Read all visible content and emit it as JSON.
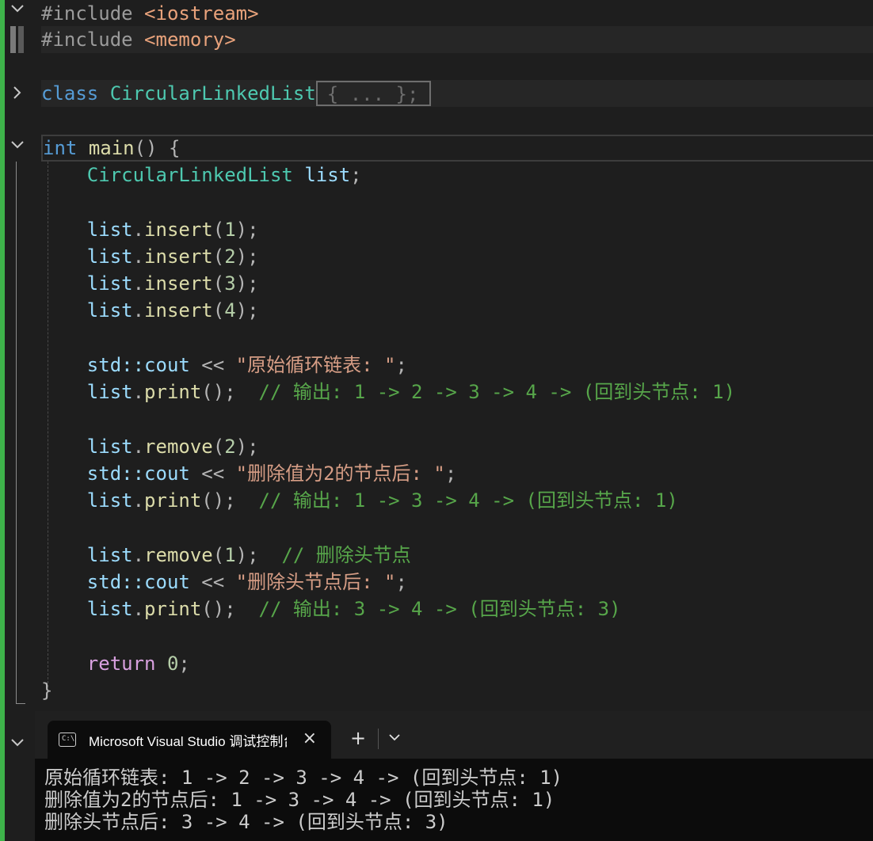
{
  "editor": {
    "lines": {
      "l1": {
        "kw": "#include",
        "inc": "<iostream>"
      },
      "l2": {
        "kw": "#include",
        "inc": "<memory>"
      },
      "l4": {
        "kw": "class",
        "name": "CircularLinkedList",
        "collapsed": "{ ... };"
      },
      "l6": {
        "kw": "int",
        "fn": "main",
        "rest": "() {"
      },
      "l7": {
        "type": "CircularLinkedList",
        "var": "list",
        "end": ";"
      },
      "l9": {
        "obj": "list",
        "mth": "insert",
        "arg": "1"
      },
      "l10": {
        "obj": "list",
        "mth": "insert",
        "arg": "2"
      },
      "l11": {
        "obj": "list",
        "mth": "insert",
        "arg": "3"
      },
      "l12": {
        "obj": "list",
        "mth": "insert",
        "arg": "4"
      },
      "l14": {
        "ns": "std::cout",
        "op": " << ",
        "str": "\"原始循环链表: \""
      },
      "l15": {
        "obj": "list",
        "mth": "print",
        "comment": "// 输出: 1 -> 2 -> 3 -> 4 -> (回到头节点: 1)"
      },
      "l17": {
        "obj": "list",
        "mth": "remove",
        "arg": "2"
      },
      "l18": {
        "ns": "std::cout",
        "op": " << ",
        "str": "\"删除值为2的节点后: \""
      },
      "l19": {
        "obj": "list",
        "mth": "print",
        "comment": "// 输出: 1 -> 3 -> 4 -> (回到头节点: 1)"
      },
      "l21": {
        "obj": "list",
        "mth": "remove",
        "arg": "1",
        "comment": "// 删除头节点"
      },
      "l22": {
        "ns": "std::cout",
        "op": " << ",
        "str": "\"删除头节点后: \""
      },
      "l23": {
        "obj": "list",
        "mth": "print",
        "comment": "// 输出: 3 -> 4 -> (回到头节点: 3)"
      },
      "l25": {
        "kw": "return",
        "num": "0"
      },
      "l26": {
        "brace": "}"
      }
    }
  },
  "terminal": {
    "tab_title": "Microsoft Visual Studio 调试控制台",
    "close_icon": "×",
    "new_tab_icon": "+",
    "output": [
      "原始循环链表: 1 -> 2 -> 3 -> 4 -> (回到头节点: 1)",
      "删除值为2的节点后: 1 -> 3 -> 4 -> (回到头节点: 1)",
      "删除头节点后: 3 -> 4 -> (回到头节点: 3)"
    ]
  },
  "colors": {
    "git_modified_bar": "#3eb34a",
    "editor_bg": "#1e1e1e",
    "terminal_bg": "#0c0c0c"
  }
}
